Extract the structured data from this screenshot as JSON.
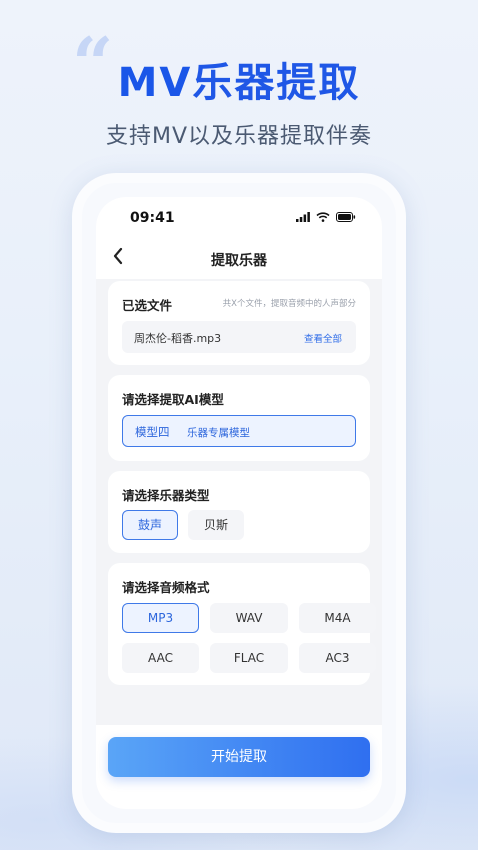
{
  "hero": {
    "quote_mark": "“",
    "title_prefix": "MV",
    "title_main": "乐器提取",
    "subtitle": "支持MV以及乐器提取伴奏"
  },
  "status_bar": {
    "time": "09:41"
  },
  "nav": {
    "back_icon": "chevron-left-icon",
    "title": "提取乐器"
  },
  "selected_file": {
    "title": "已选文件",
    "hint": "共X个文件，提取音频中的人声部分",
    "file_name": "周杰伦-稻香.mp3",
    "view_all": "查看全部"
  },
  "ai_model": {
    "title": "请选择提取AI模型",
    "selected_name": "模型四",
    "selected_desc": "乐器专属模型"
  },
  "instrument_type": {
    "title": "请选择乐器类型",
    "options": [
      {
        "label": "鼓声",
        "active": true
      },
      {
        "label": "贝斯",
        "active": false
      }
    ]
  },
  "audio_format": {
    "title": "请选择音频格式",
    "options": [
      {
        "label": "MP3",
        "active": true
      },
      {
        "label": "WAV",
        "active": false
      },
      {
        "label": "M4A",
        "active": false
      },
      {
        "label": "AAC",
        "active": false
      },
      {
        "label": "FLAC",
        "active": false
      },
      {
        "label": "AC3",
        "active": false
      }
    ]
  },
  "actions": {
    "start_label": "开始提取"
  },
  "colors": {
    "accent": "#2f6ff0",
    "accent_light": "#edf3ff",
    "title_blue": "#1f57e6"
  }
}
